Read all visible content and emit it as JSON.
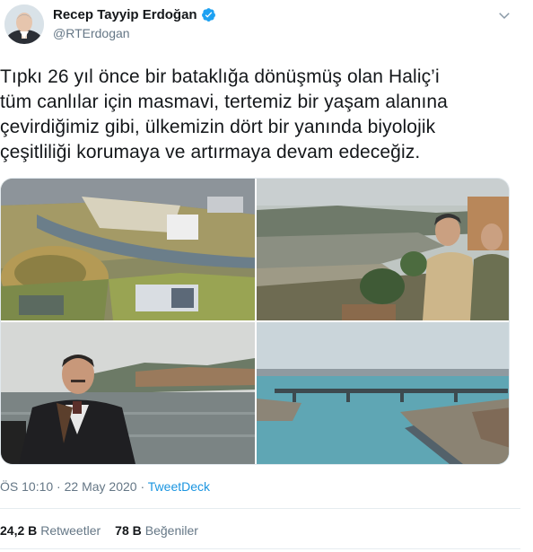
{
  "author": {
    "name": "Recep Tayyip Erdoğan",
    "handle": "@RTErdogan"
  },
  "tweet": {
    "text_lines": [
      "Tıpkı 26 yıl önce bir bataklığa dönüşmüş olan Haliç’i",
      "tüm canlılar için masmavi, tertemiz bir yaşam alanına",
      "çevirdiğimiz gibi, ülkemizin dört bir yanında biyolojik",
      "çeşitliliği korumaya ve artırmaya devam edeceğiz."
    ],
    "time": "ÖS 10:10",
    "date": "22 May 2020",
    "separator": "·",
    "source": "TweetDeck"
  },
  "stats": {
    "retweets_count": "24,2 B",
    "retweets_label": "Retweetler",
    "likes_count": "78 B",
    "likes_label": "Beğeniler"
  },
  "colors": {
    "verified_blue": "#1da1f2",
    "link_blue": "#1b95e0",
    "muted_gray": "#657786"
  },
  "icons": {
    "verified": "verified-badge-icon",
    "menu": "chevron-down-icon"
  }
}
